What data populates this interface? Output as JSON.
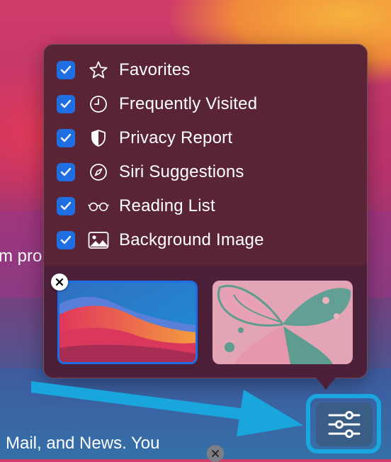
{
  "background": {
    "peek_left_text": "m pro",
    "peek_bottom_text": "Mail, and News. You"
  },
  "popover": {
    "items": [
      {
        "label": "Favorites",
        "checked": true,
        "icon": "star-icon"
      },
      {
        "label": "Frequently Visited",
        "checked": true,
        "icon": "clock-icon"
      },
      {
        "label": "Privacy Report",
        "checked": true,
        "icon": "shield-icon"
      },
      {
        "label": "Siri Suggestions",
        "checked": true,
        "icon": "compass-icon"
      },
      {
        "label": "Reading List",
        "checked": true,
        "icon": "glasses-icon"
      },
      {
        "label": "Background Image",
        "checked": true,
        "icon": "image-icon"
      }
    ],
    "backgrounds": [
      {
        "name": "macos-big-sur-wallpaper",
        "selected": true
      },
      {
        "name": "butterfly-wallpaper",
        "selected": false
      }
    ]
  },
  "colors": {
    "checkbox": "#1f6fe3",
    "selection_border": "#1d6de6",
    "callout_highlight": "#1aa6de",
    "customize_button": "#3a5d86"
  },
  "customize_button": {
    "icon": "sliders-icon"
  },
  "annotation": {
    "arrow_icon": "arrow-right-icon"
  }
}
